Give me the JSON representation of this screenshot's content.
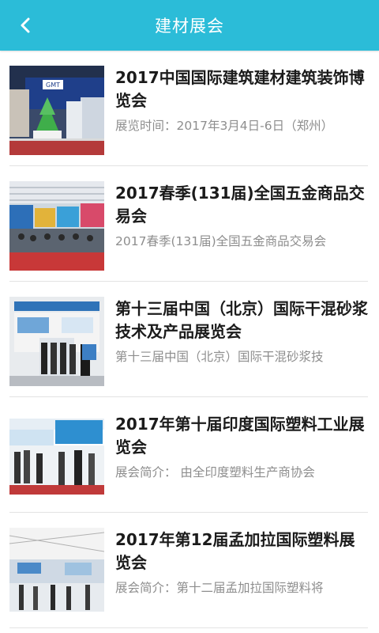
{
  "header": {
    "title": "建材展会",
    "back_icon": "chevron-left-icon",
    "background": "#2bbcd8"
  },
  "items": [
    {
      "title": "2017中国国际建筑建材建筑装饰博览会",
      "desc": "展览时间：2017年3月4日-6日（郑州）",
      "image_badge": "GMT"
    },
    {
      "title": "2017春季(131届)全国五金商品交易会",
      "desc": "2017春季(131届)全国五金商品交易会",
      "image_badge": ""
    },
    {
      "title": "第十三届中国（北京）国际干混砂浆技术及产品展览会",
      "desc": "第十三届中国（北京）国际干混砂浆技",
      "image_badge": ""
    },
    {
      "title": "2017年第十届印度国际塑料工业展览会",
      "desc": "展会简介： 由全印度塑料生产商协会",
      "image_badge": ""
    },
    {
      "title": "2017年第12届孟加拉国际塑料展览会",
      "desc": "展会简介：第十二届孟加拉国际塑料将",
      "image_badge": ""
    }
  ]
}
